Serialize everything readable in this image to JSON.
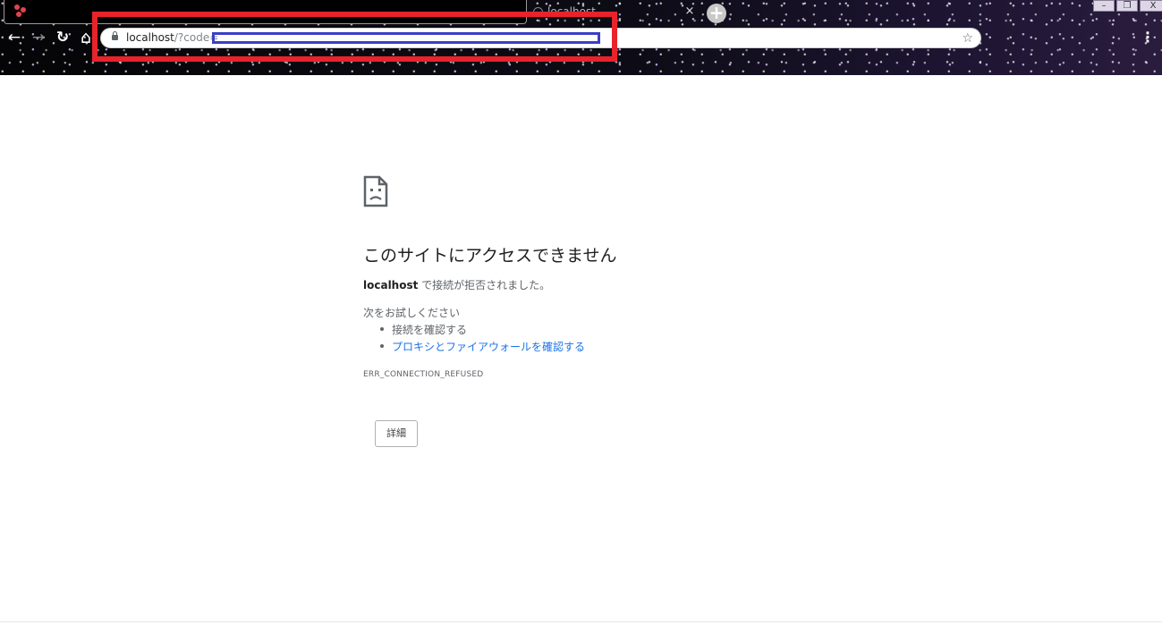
{
  "browser": {
    "tab_active_title": "",
    "tab_inactive_title": "localhost",
    "tab_close_glyph": "×",
    "new_tab_glyph": "+",
    "window_controls": {
      "minimize": "–",
      "restore": "❐",
      "close": "X"
    },
    "nav": {
      "back": "←",
      "forward": "→",
      "reload": "↻",
      "home": "⌂"
    },
    "address": {
      "host": "localhost",
      "path": "/?code=",
      "redacted": true
    },
    "star_glyph": "☆",
    "menu_glyph": "⋮",
    "icons": [
      "back-icon",
      "forward-icon",
      "reload-icon",
      "home-icon",
      "lock-icon",
      "star-icon",
      "menu-icon"
    ]
  },
  "annotations": {
    "red_box_color": "#e8232b",
    "blue_box_color": "#3b3fc4"
  },
  "error_page": {
    "icon": "sad-document-icon",
    "title": "このサイトにアクセスできません",
    "description_host": "localhost",
    "description_rest": " で接続が拒否されました。",
    "try_label": "次をお試しください",
    "suggestions": [
      "接続を確認する",
      "プロキシとファイアウォールを確認する"
    ],
    "error_code": "ERR_CONNECTION_REFUSED",
    "details_button": "詳細",
    "link_color": "#1a73e8"
  }
}
